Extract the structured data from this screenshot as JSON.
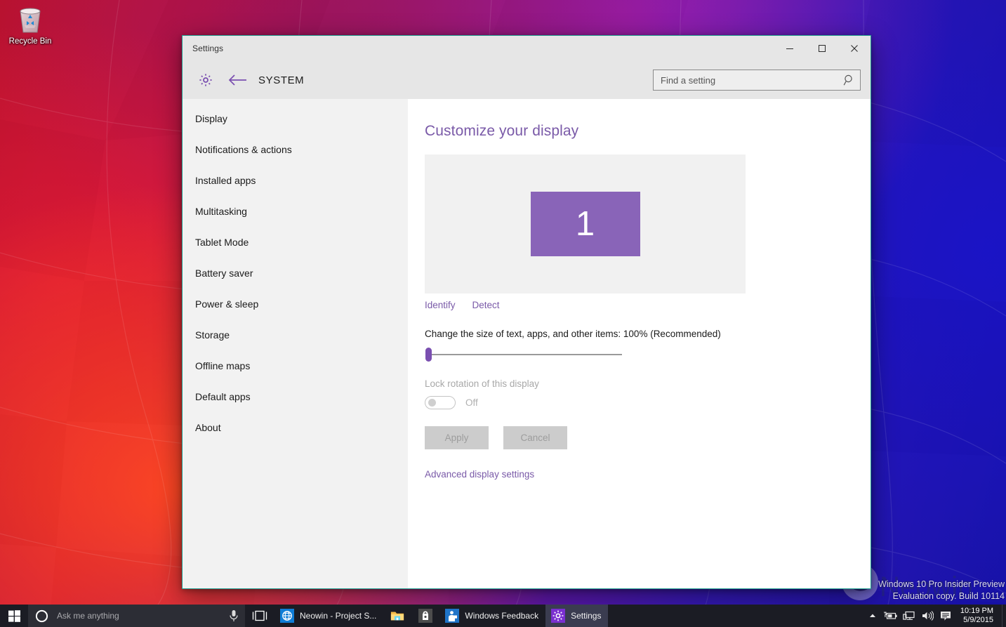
{
  "desktop": {
    "recycle_bin": {
      "label": "Recycle Bin",
      "icon": "recycle-bin-icon"
    },
    "watermark": {
      "line1": "Windows 10 Pro Insider Preview",
      "line2": "Evaluation copy. Build 10114"
    },
    "logo_text": "Neowin"
  },
  "window": {
    "title": "Settings",
    "border_color": "#1e9b8e",
    "controls": {
      "minimize": "minimize-button",
      "maximize": "maximize-button",
      "close": "close-button"
    }
  },
  "header": {
    "gear_icon": "gear-icon",
    "back_icon": "back-arrow-icon",
    "page_title": "SYSTEM",
    "accent_color": "#7a5aa8"
  },
  "search": {
    "placeholder": "Find a setting",
    "value": "",
    "icon": "search-icon"
  },
  "sidebar": {
    "items": [
      {
        "label": "Display",
        "selected": true
      },
      {
        "label": "Notifications & actions",
        "selected": false
      },
      {
        "label": "Installed apps",
        "selected": false
      },
      {
        "label": "Multitasking",
        "selected": false
      },
      {
        "label": "Tablet Mode",
        "selected": false
      },
      {
        "label": "Battery saver",
        "selected": false
      },
      {
        "label": "Power & sleep",
        "selected": false
      },
      {
        "label": "Storage",
        "selected": false
      },
      {
        "label": "Offline maps",
        "selected": false
      },
      {
        "label": "Default apps",
        "selected": false
      },
      {
        "label": "About",
        "selected": false
      }
    ]
  },
  "content": {
    "title": "Customize your display",
    "monitor_number": "1",
    "identify_link": "Identify",
    "detect_link": "Detect",
    "scale_label": "Change the size of text, apps, and other items: 100% (Recommended)",
    "scale_value": 100,
    "scale_position_percent": 0,
    "rotation_label": "Lock rotation of this display",
    "rotation_state": "Off",
    "rotation_enabled": false,
    "apply_button": "Apply",
    "cancel_button": "Cancel",
    "advanced_link": "Advanced display settings"
  },
  "taskbar": {
    "start_icon": "windows-start-icon",
    "cortana": {
      "icon": "cortana-circle-icon",
      "placeholder": "Ask me anything",
      "mic_icon": "microphone-icon"
    },
    "task_view_icon": "task-view-icon",
    "tasks": [
      {
        "label": "Neowin - Project S...",
        "icon": "edge-browser-icon",
        "active": false,
        "icon_only": false
      },
      {
        "label": "",
        "icon": "file-explorer-icon",
        "active": false,
        "icon_only": true
      },
      {
        "label": "",
        "icon": "store-icon",
        "active": false,
        "icon_only": true
      },
      {
        "label": "Windows Feedback",
        "icon": "feedback-icon",
        "active": false,
        "icon_only": false
      },
      {
        "label": "Settings",
        "icon": "settings-gear-icon",
        "active": true,
        "icon_only": false
      }
    ],
    "tray": [
      {
        "name": "show-hidden-icons-chevron"
      },
      {
        "name": "battery-icon"
      },
      {
        "name": "network-icon"
      },
      {
        "name": "volume-icon"
      },
      {
        "name": "action-center-icon"
      }
    ],
    "clock": {
      "time": "10:19 PM",
      "date": "5/9/2015"
    }
  }
}
